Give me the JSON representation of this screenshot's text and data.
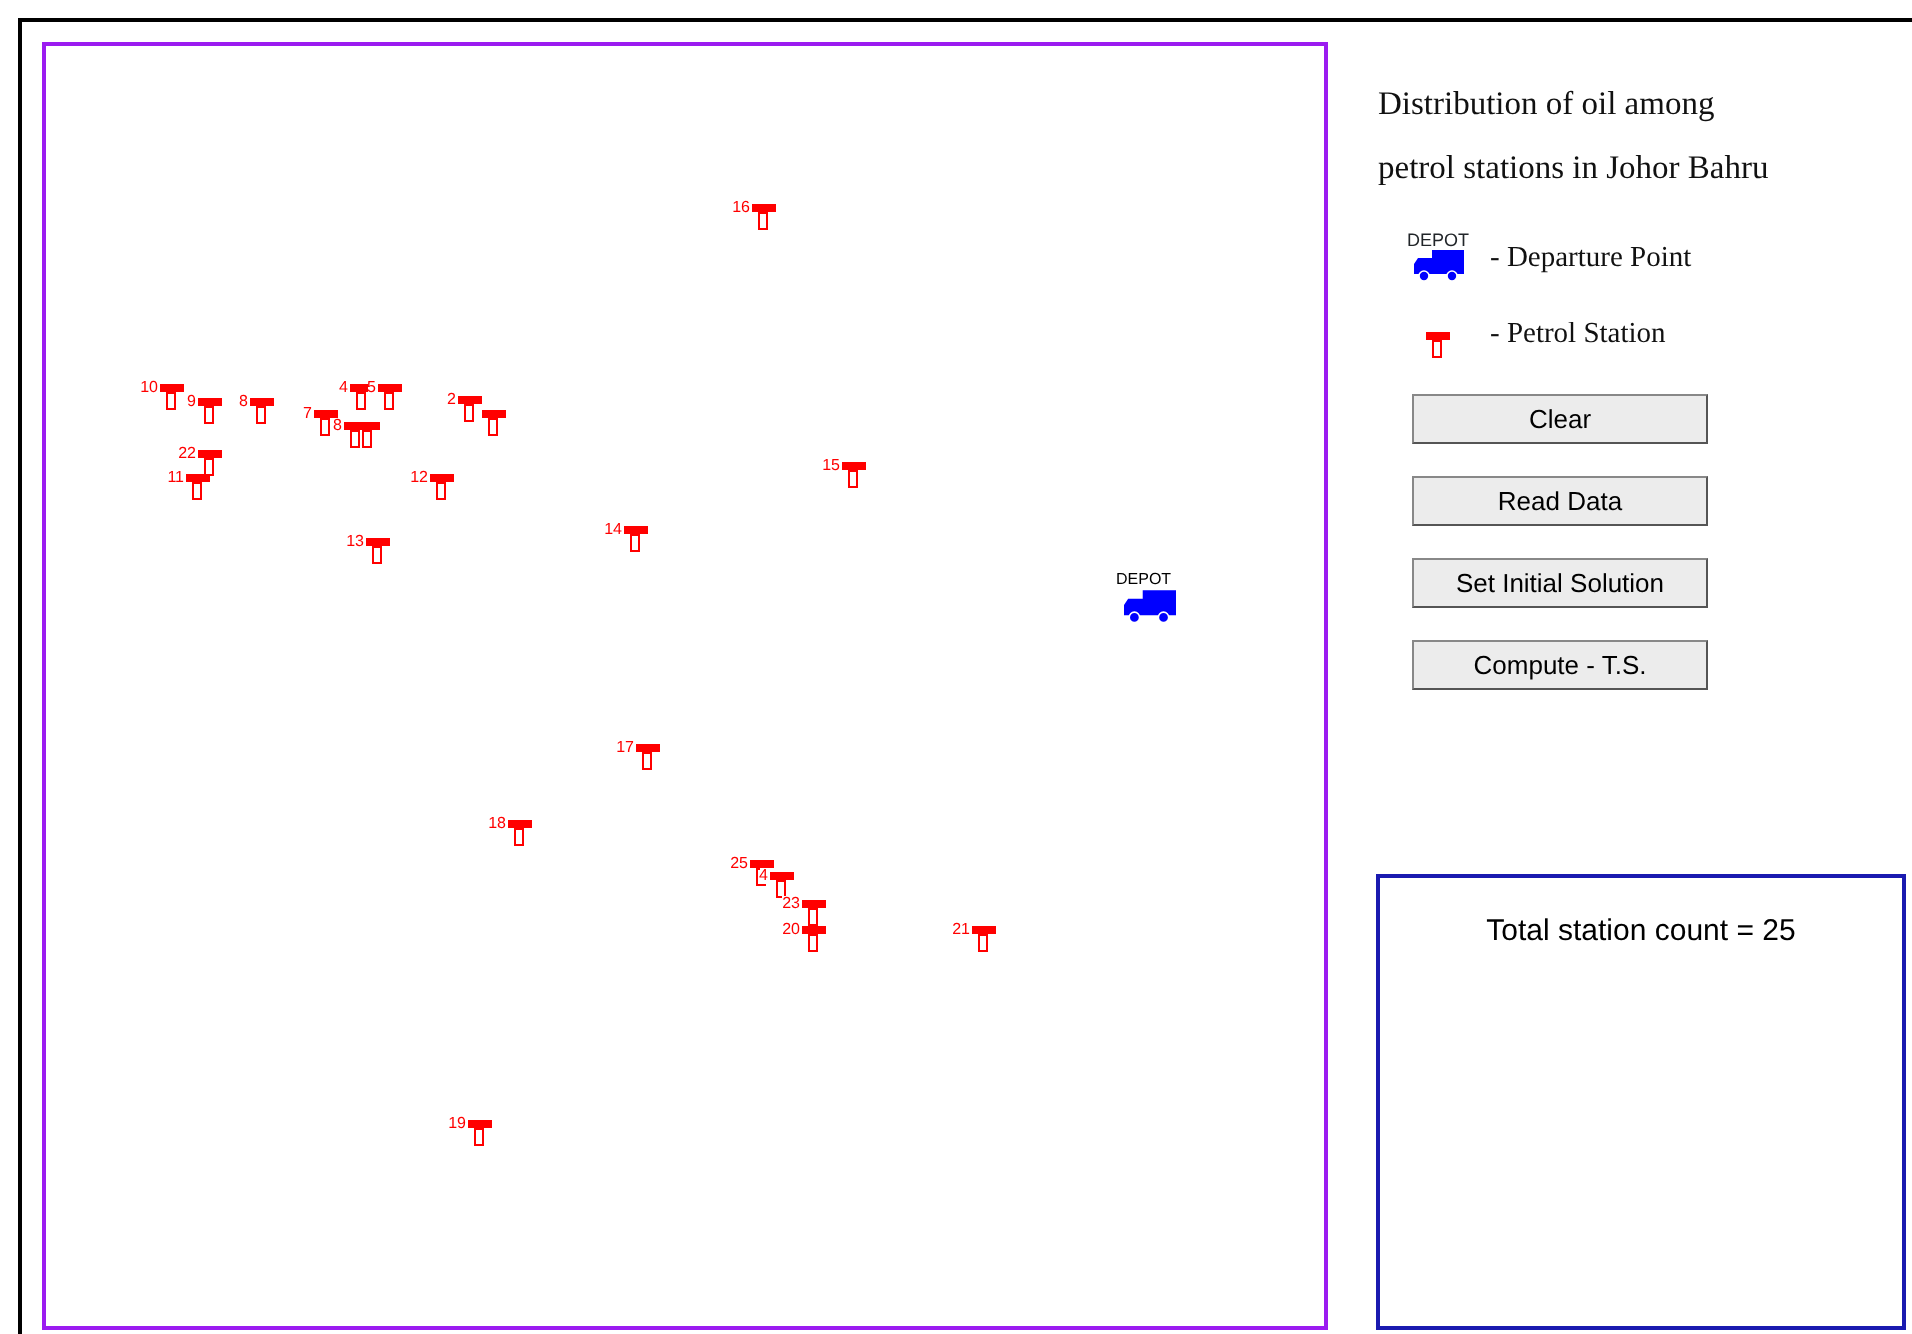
{
  "map": {
    "depot": {
      "label": "DEPOT"
    },
    "stations": [
      {
        "kind": "labeled",
        "label": "16"
      },
      {
        "kind": "labeled",
        "label": "10"
      },
      {
        "kind": "labeled",
        "label": "9"
      },
      {
        "kind": "labeled",
        "label": "8"
      },
      {
        "kind": "labeled",
        "label": "4"
      },
      {
        "kind": "labeled",
        "label": "5"
      },
      {
        "kind": "labeled",
        "label": "2"
      },
      {
        "kind": "unlabeled"
      },
      {
        "kind": "labeled",
        "label": "7"
      },
      {
        "kind": "labeled",
        "label": "8"
      },
      {
        "kind": "unlabeled"
      },
      {
        "kind": "labeled",
        "label": "22"
      },
      {
        "kind": "labeled",
        "label": "11"
      },
      {
        "kind": "labeled",
        "label": "12"
      },
      {
        "kind": "labeled",
        "label": "15"
      },
      {
        "kind": "labeled",
        "label": "14"
      },
      {
        "kind": "labeled",
        "label": "13"
      },
      {
        "kind": "labeled",
        "label": "17"
      },
      {
        "kind": "labeled",
        "label": "18"
      },
      {
        "kind": "labeled",
        "label": "25"
      },
      {
        "kind": "labeled",
        "label": "4"
      },
      {
        "kind": "labeled",
        "label": "23"
      },
      {
        "kind": "labeled",
        "label": "20"
      },
      {
        "kind": "labeled",
        "label": "21"
      },
      {
        "kind": "labeled",
        "label": "19"
      }
    ]
  },
  "panel": {
    "title": "Distribution of oil among petrol stations in Johor Bahru",
    "legend": [
      {
        "kind": "depot",
        "caption": "DEPOT",
        "text": "- Departure Point"
      },
      {
        "kind": "station",
        "text": "- Petrol Station"
      }
    ],
    "buttons": [
      "Clear",
      "Read Data",
      "Set Initial Solution",
      "Compute - T.S."
    ],
    "result": "Total station count = 25"
  }
}
